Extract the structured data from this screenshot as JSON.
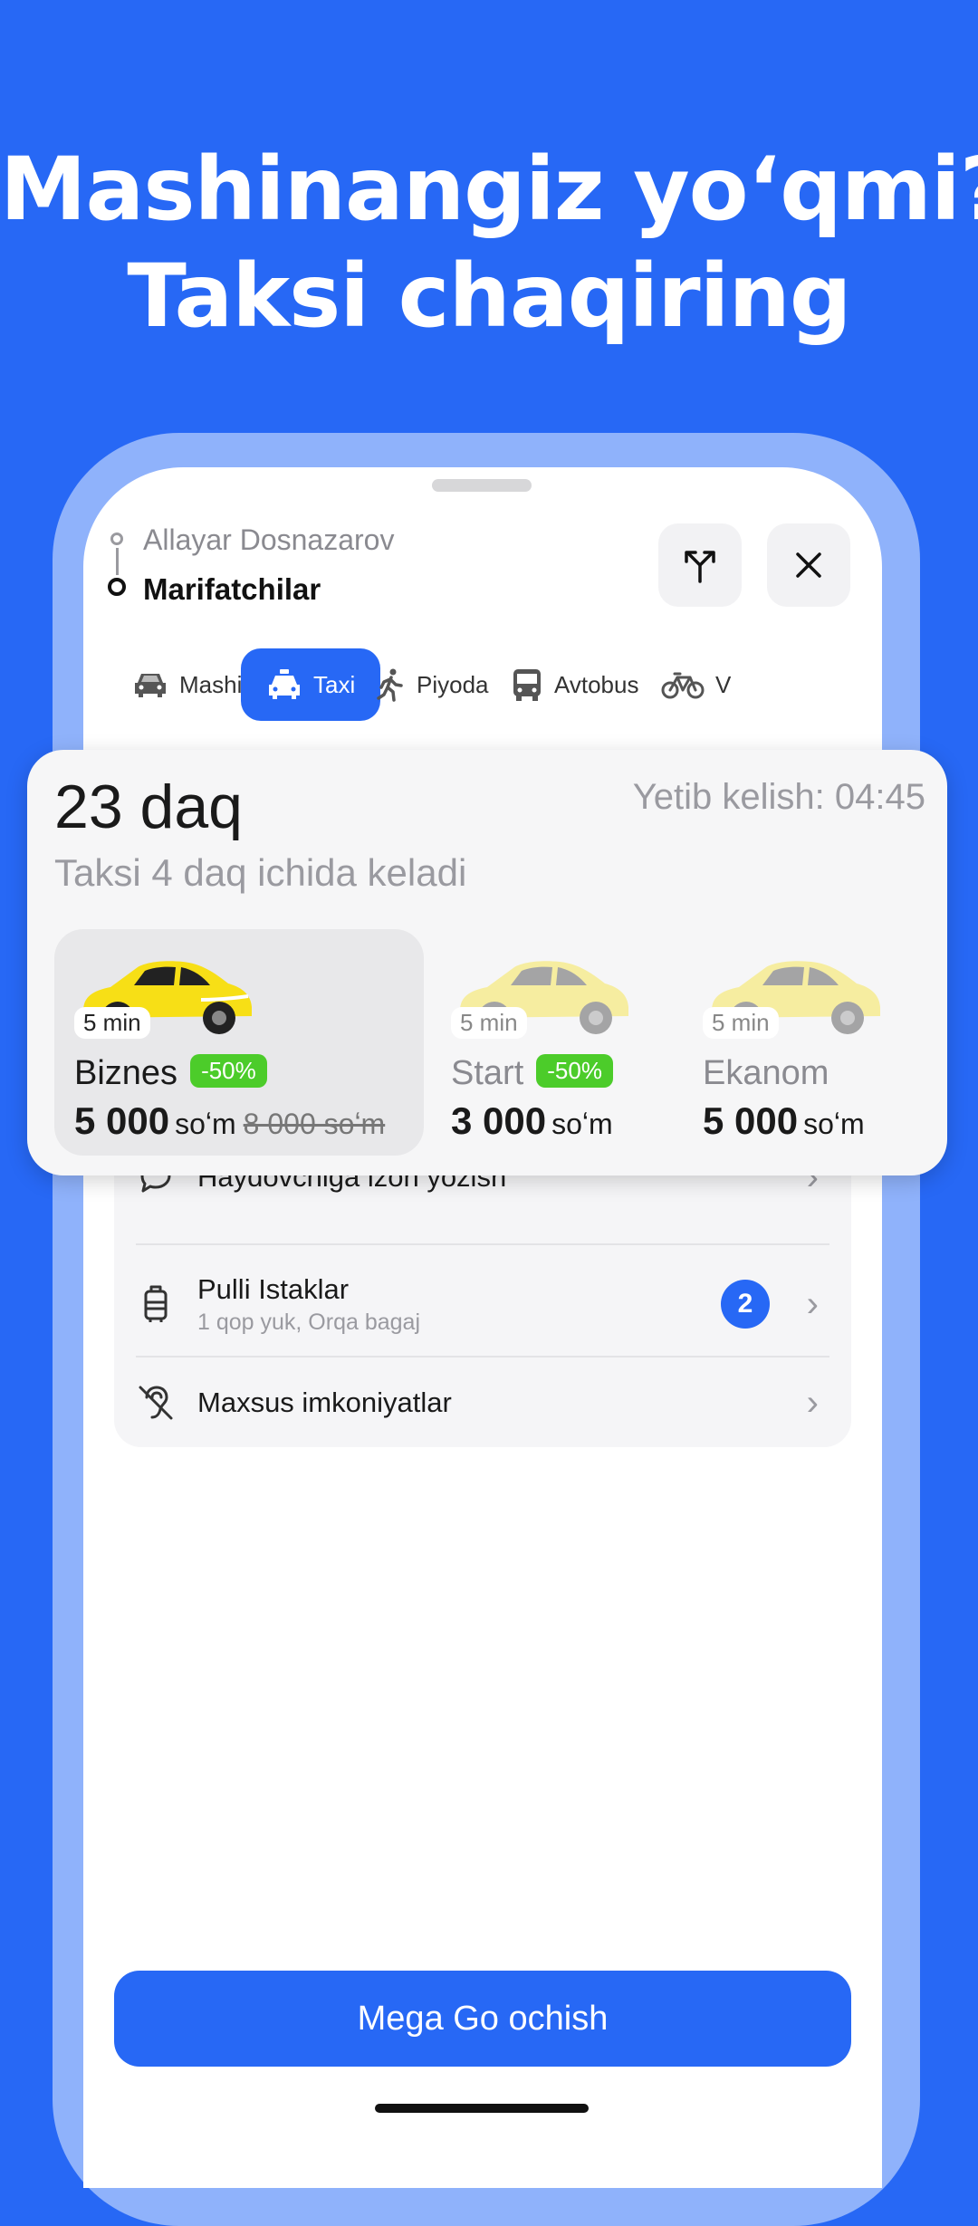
{
  "headline": {
    "line1": "Mashinangiz yoʻqmi?",
    "line2": "Taksi chaqiring"
  },
  "route": {
    "from": "Allayar Dosnazarov",
    "to": "Marifatchilar"
  },
  "tabs": [
    {
      "label": "Mashina",
      "icon": "car-icon"
    },
    {
      "label": "Taxi",
      "icon": "taxi-icon",
      "active": true
    },
    {
      "label": "Piyoda",
      "icon": "walking-icon"
    },
    {
      "label": "Avtobus",
      "icon": "bus-icon"
    },
    {
      "label": "V",
      "icon": "bicycle-icon"
    }
  ],
  "trip": {
    "duration": "23 daq",
    "arrival": "Yetib kelish: 04:45",
    "taxi_note": "Taksi 4 daq ichida keladi"
  },
  "tariffs": [
    {
      "eta": "5 min",
      "name": "Biznes",
      "discount": "-50%",
      "price": "5 000",
      "currency": "soʻm",
      "old_price": "8 000 soʻm",
      "selected": true
    },
    {
      "eta": "5 min",
      "name": "Start",
      "discount": "-50%",
      "price": "3 000",
      "currency": "soʻm"
    },
    {
      "eta": "5 min",
      "name": "Ekanom",
      "price": "5 000",
      "currency": "soʻm"
    }
  ],
  "options": [
    {
      "title": "Haydovchiga izoh yozish",
      "icon": "chat-bubble-icon"
    },
    {
      "title": "Pulli Istaklar",
      "subtitle": "1 qop yuk, Orqa bagaj",
      "badge": "2",
      "icon": "luggage-icon"
    },
    {
      "title": "Maxsus imkoniyatlar",
      "icon": "hearing-disabled-icon"
    }
  ],
  "cta": {
    "label": "Mega Go ochish"
  },
  "colors": {
    "brand": "#2768f5",
    "frame": "#8fb2fb",
    "discount": "#4ccc2a",
    "taxi_yellow": "#f7df16"
  }
}
